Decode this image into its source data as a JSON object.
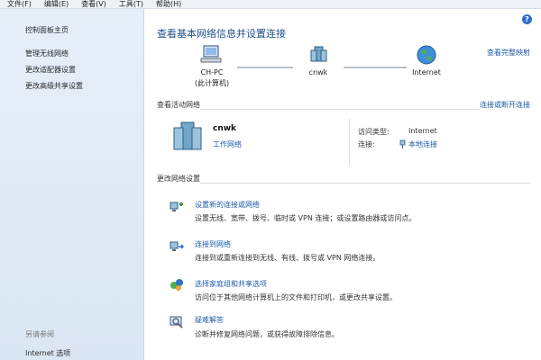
{
  "menubar": {
    "items": [
      "文件(F)",
      "编辑(E)",
      "查看(V)",
      "工具(T)",
      "帮助(H)"
    ]
  },
  "sidebar": {
    "home_link": "控制面板主页",
    "tasks": [
      "管理无线网络",
      "更改适配器设置",
      "更改高级共享设置"
    ],
    "see_also_header": "另请参阅",
    "see_also_items": [
      "Internet 选项"
    ]
  },
  "main": {
    "title": "查看基本网络信息并设置连接",
    "full_map_link": "查看完整映射",
    "map": {
      "computer_name": "CH-PC",
      "computer_sub": "(此计算机)",
      "network_name": "cnwk",
      "internet_label": "Internet"
    },
    "active_section": {
      "title": "查看活动网络",
      "action": "连接或断开连接",
      "network_name": "cnwk",
      "network_type": "工作网络",
      "access_type_label": "访问类型:",
      "access_type_value": "Internet",
      "connection_label": "连接:",
      "connection_value": "本地连接"
    },
    "change_section": {
      "title": "更改网络设置",
      "tasks": [
        {
          "title": "设置新的连接或网络",
          "desc": "设置无线、宽带、拨号、临时或 VPN 连接；或设置路由器或访问点。",
          "icon": "new-connection-icon"
        },
        {
          "title": "连接到网络",
          "desc": "连接到或重新连接到无线、有线、拨号或 VPN 网络连接。",
          "icon": "connect-network-icon"
        },
        {
          "title": "选择家庭组和共享选项",
          "desc": "访问位于其他网络计算机上的文件和打印机，或更改共享设置。",
          "icon": "homegroup-icon"
        },
        {
          "title": "疑难解答",
          "desc": "诊断并修复网络问题，或获得故障排除信息。",
          "icon": "troubleshoot-icon"
        }
      ]
    }
  },
  "colors": {
    "link": "#1e5aa8",
    "title": "#1d4e89",
    "sidebar_bg": "#dbe6f4"
  }
}
